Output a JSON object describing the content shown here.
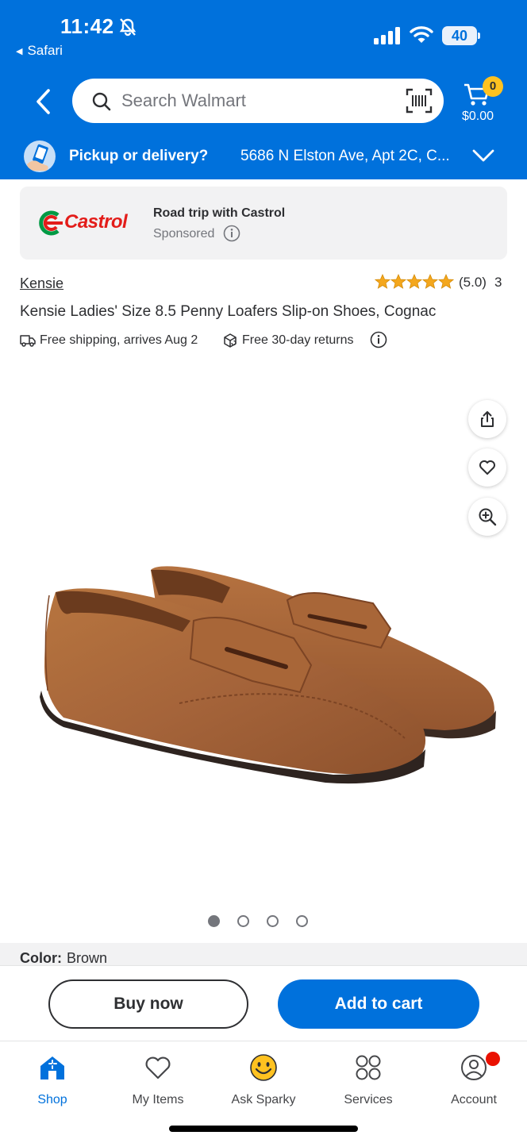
{
  "status_bar": {
    "time": "11:42",
    "back_app": "Safari",
    "battery": "40"
  },
  "header": {
    "search_placeholder": "Search Walmart",
    "cart_count": "0",
    "cart_total": "$0.00",
    "pickup_label": "Pickup or delivery?",
    "address": "5686 N Elston Ave, Apt 2C, C..."
  },
  "ad": {
    "brand_logo_text": "Castrol",
    "title": "Road trip with Castrol",
    "sponsored": "Sponsored"
  },
  "product": {
    "brand": "Kensie",
    "rating_value": 5.0,
    "rating_text": "(5.0)",
    "review_count": "3",
    "title": "Kensie Ladies' Size 8.5 Penny Loafers Slip-on Shoes, Cognac",
    "shipping": "Free shipping, arrives Aug 2",
    "returns": "Free 30-day returns",
    "image_count": 4,
    "active_image": 1,
    "color_label": "Color:",
    "color_value": "Brown"
  },
  "actions": {
    "buy_now": "Buy now",
    "add_to_cart": "Add to cart"
  },
  "bottom_nav": [
    {
      "label": "Shop",
      "icon": "shop-icon",
      "active": true
    },
    {
      "label": "My Items",
      "icon": "heart-icon"
    },
    {
      "label": "Ask Sparky",
      "icon": "sparky-icon"
    },
    {
      "label": "Services",
      "icon": "services-icon"
    },
    {
      "label": "Account",
      "icon": "account-icon",
      "badge": true
    }
  ],
  "colors": {
    "brand_blue": "#0071dc",
    "spark_yellow": "#ffc220",
    "alert_red": "#ea1100",
    "castrol_red": "#e31d1a",
    "castrol_green": "#009a44",
    "star_gold": "#f4a71d",
    "shoe_brown": "#a8653a"
  }
}
